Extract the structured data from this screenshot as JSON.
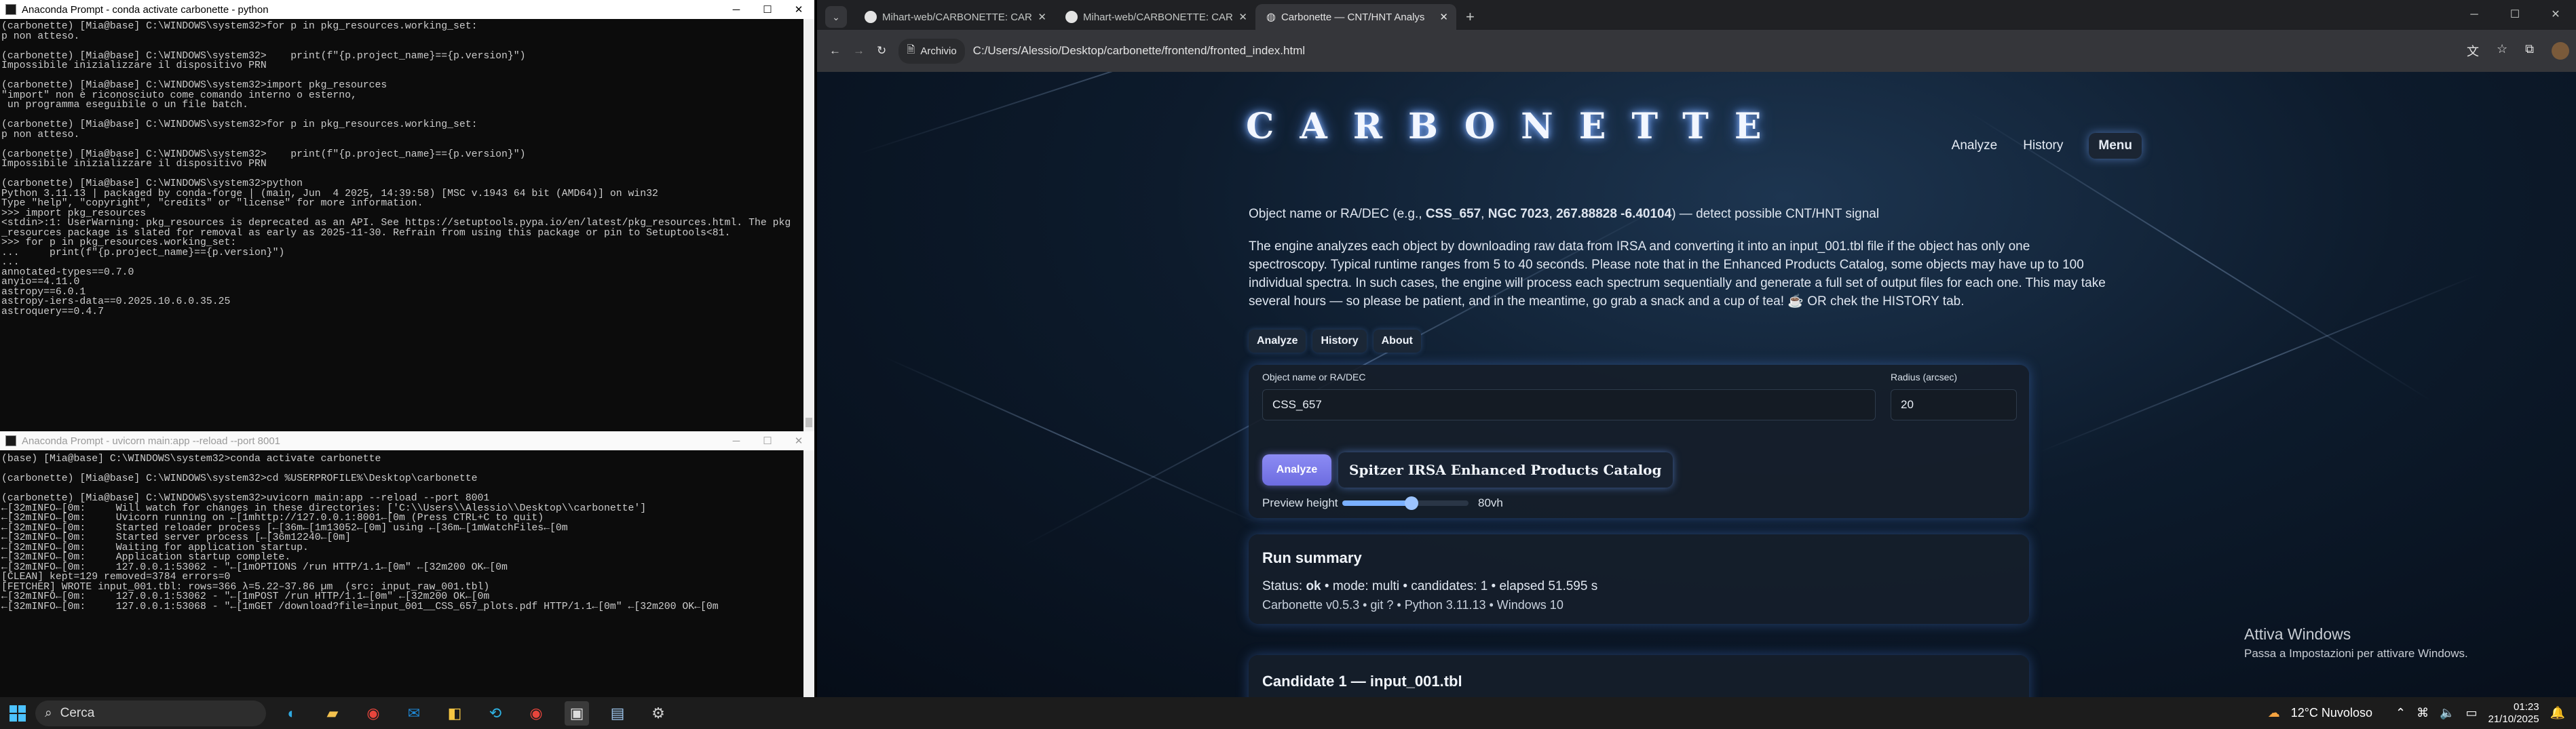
{
  "terminal_top": {
    "title": "Anaconda Prompt - conda  activate carbonette - python",
    "lines": [
      "(carbonette) [Mia@base] C:\\WINDOWS\\system32>for p in pkg_resources.working_set:",
      "p non atteso.",
      "",
      "(carbonette) [Mia@base] C:\\WINDOWS\\system32>    print(f\"{p.project_name}=={p.version}\")",
      "Impossibile inizializzare il dispositivo PRN",
      "",
      "(carbonette) [Mia@base] C:\\WINDOWS\\system32>import pkg_resources",
      "\"import\" non è riconosciuto come comando interno o esterno,",
      " un programma eseguibile o un file batch.",
      "",
      "(carbonette) [Mia@base] C:\\WINDOWS\\system32>for p in pkg_resources.working_set:",
      "p non atteso.",
      "",
      "(carbonette) [Mia@base] C:\\WINDOWS\\system32>    print(f\"{p.project_name}=={p.version}\")",
      "Impossibile inizializzare il dispositivo PRN",
      "",
      "(carbonette) [Mia@base] C:\\WINDOWS\\system32>python",
      "Python 3.11.13 | packaged by conda-forge | (main, Jun  4 2025, 14:39:58) [MSC v.1943 64 bit (AMD64)] on win32",
      "Type \"help\", \"copyright\", \"credits\" or \"license\" for more information.",
      ">>> import pkg_resources",
      "<stdin>:1: UserWarning: pkg_resources is deprecated as an API. See https://setuptools.pypa.io/en/latest/pkg_resources.html. The pkg",
      "_resources package is slated for removal as early as 2025-11-30. Refrain from using this package or pin to Setuptools<81.",
      ">>> for p in pkg_resources.working_set:",
      "...     print(f\"{p.project_name}=={p.version}\")",
      "...",
      "annotated-types==0.7.0",
      "anyio==4.11.0",
      "astropy==6.0.1",
      "astropy-iers-data==0.2025.10.6.0.35.25",
      "astroquery==0.4.7"
    ]
  },
  "terminal_bottom": {
    "title": "Anaconda Prompt - uvicorn  main:app --reload --port 8001",
    "lines": [
      "(base) [Mia@base] C:\\WINDOWS\\system32>conda activate carbonette",
      "",
      "(carbonette) [Mia@base] C:\\WINDOWS\\system32>cd %USERPROFILE%\\Desktop\\carbonette",
      "",
      "(carbonette) [Mia@base] C:\\WINDOWS\\system32>uvicorn main:app --reload --port 8001",
      "←[32mINFO←[0m:     Will watch for changes in these directories: ['C:\\\\Users\\\\Alessio\\\\Desktop\\\\carbonette']",
      "←[32mINFO←[0m:     Uvicorn running on ←[1mhttp://127.0.0.1:8001←[0m (Press CTRL+C to quit)",
      "←[32mINFO←[0m:     Started reloader process [←[36m←[1m13052←[0m] using ←[36m←[1mWatchFiles←[0m",
      "←[32mINFO←[0m:     Started server process [←[36m12240←[0m]",
      "←[32mINFO←[0m:     Waiting for application startup.",
      "←[32mINFO←[0m:     Application startup complete.",
      "←[32mINFO←[0m:     127.0.0.1:53062 - \"←[1mOPTIONS /run HTTP/1.1←[0m\" ←[32m200 OK←[0m",
      "[CLEAN] kept=129 removed=3784 errors=0",
      "[FETCHER] WROTE input_001.tbl: rows=366 λ=5.22–37.86 µm  (src: input_raw_001.tbl)",
      "←[32mINFO←[0m:     127.0.0.1:53062 - \"←[1mPOST /run HTTP/1.1←[0m\" ←[32m200 OK←[0m",
      "←[32mINFO←[0m:     127.0.0.1:53068 - \"←[1mGET /download?file=input_001__CSS_657_plots.pdf HTTP/1.1←[0m\" ←[32m200 OK←[0m"
    ]
  },
  "browser": {
    "tabs": [
      {
        "label": "Mihart-web/CARBONETTE: CAR"
      },
      {
        "label": "Mihart-web/CARBONETTE: CAR"
      },
      {
        "label": "Carbonette — CNT/HNT Analys"
      }
    ],
    "archive_chip": "Archivio",
    "url": "C:/Users/Alessio/Desktop/carbonette/frontend/fronted_index.html"
  },
  "page": {
    "logo": "CARBONETTE",
    "nav": {
      "analyze": "Analyze",
      "history": "History",
      "menu": "Menu"
    },
    "intro_before": "Object name or RA/DEC (e.g., ",
    "ex1": "CSS_657",
    "ex2": "NGC 7023",
    "ex3": "267.88828 -6.40104",
    "intro_after": ") — detect possible CNT/HNT signal",
    "desc": [
      "The engine analyzes each object by downloading raw data from IRSA and converting it into an input_001.tbl file if the object has only one",
      "spectroscopy. Typical runtime ranges from 5 to 40 seconds. Please note that in the Enhanced Products Catalog, some objects may have up to 100",
      "individual spectra. In such cases, the engine will process each spectrum sequentially and generate a full set of output files for each one. This may take",
      "several hours — so please be patient, and in the meantime, go grab a snack and a cup of tea! ☕ OR chek the HISTORY tab."
    ],
    "tabs": {
      "analyze": "Analyze",
      "history": "History",
      "about": "About"
    },
    "form": {
      "object_label": "Object name or RA/DEC",
      "object_value": "CSS_657",
      "radius_label": "Radius (arcsec)",
      "radius_value": "20",
      "analyze_button": "Analyze",
      "catalog_button": "Spitzer IRSA Enhanced Products Catalog",
      "preview_label": "Preview height",
      "preview_value": "80vh",
      "preview_fraction": 0.55
    },
    "run_summary": {
      "title": "Run summary",
      "status_label": "Status:",
      "status_value": "ok",
      "rest": " • mode: multi • candidates: 1 • elapsed 51.595 s",
      "versions": "Carbonette v0.5.3 • git ? • Python 3.11.13 • Windows 10"
    },
    "candidate_title": "Candidate 1 — input_001.tbl",
    "watermark_title": "Attiva Windows",
    "watermark_sub": "Passa a Impostazioni per attivare Windows."
  },
  "taskbar": {
    "search": "Cerca",
    "weather": "12°C  Nuvoloso",
    "time": "01:23",
    "date": "21/10/2025"
  }
}
